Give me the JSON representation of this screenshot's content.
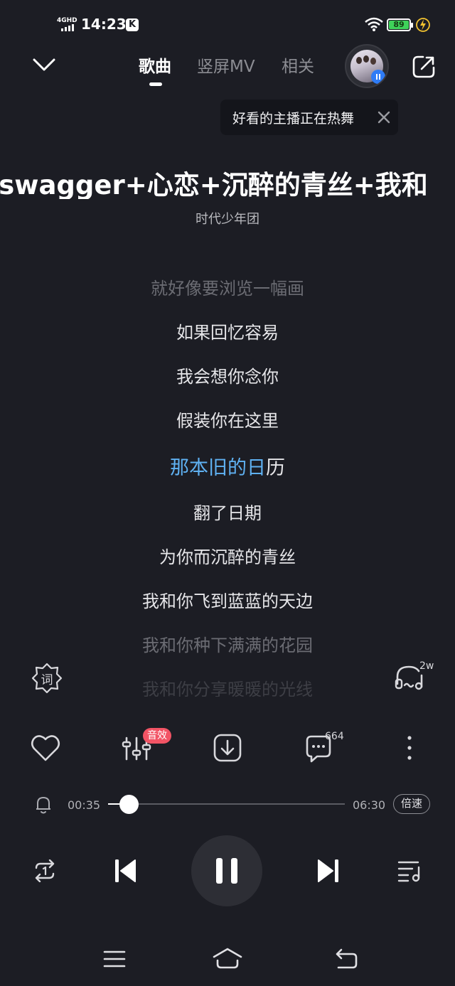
{
  "status_bar": {
    "network": "4GHD",
    "time": "14:23",
    "app_badge": "K",
    "battery": "89"
  },
  "header": {
    "tabs": [
      {
        "label": "歌曲",
        "active": true
      },
      {
        "label": "竖屏MV",
        "active": false
      },
      {
        "label": "相关",
        "active": false
      }
    ]
  },
  "tooltip": {
    "text": "好看的主播正在热舞"
  },
  "song": {
    "title": "swagger+心恋+沉醉的青丝+我和",
    "artist": "时代少年团"
  },
  "lyrics": {
    "lines": [
      {
        "text": "就好像要浏览一幅画",
        "state": "dim"
      },
      {
        "text": "如果回忆容易",
        "state": "normal"
      },
      {
        "text": "我会想你念你",
        "state": "normal"
      },
      {
        "text": "假装你在这里",
        "state": "normal"
      },
      {
        "text": "翻了日期",
        "state": "normal"
      },
      {
        "text": "为你而沉醉的青丝",
        "state": "normal"
      },
      {
        "text": "我和你飞到蓝蓝的天边",
        "state": "normal"
      },
      {
        "text": "我和你种下满满的花园",
        "state": "dim"
      },
      {
        "text": "我和你分享暖暖的光线",
        "state": "fade"
      }
    ],
    "current": {
      "sung": "那本旧的日",
      "unsung": "历"
    }
  },
  "side": {
    "lyric_button": "词",
    "listeners": "2w"
  },
  "actions": {
    "effects_badge": "音效",
    "comments": "664"
  },
  "player": {
    "current_time": "00:35",
    "total_time": "06:30",
    "progress": 0.09,
    "speed_label": "倍速"
  },
  "colors": {
    "background": "#1c1d24",
    "accent": "#5fb1f2",
    "badge": "#f25465"
  }
}
